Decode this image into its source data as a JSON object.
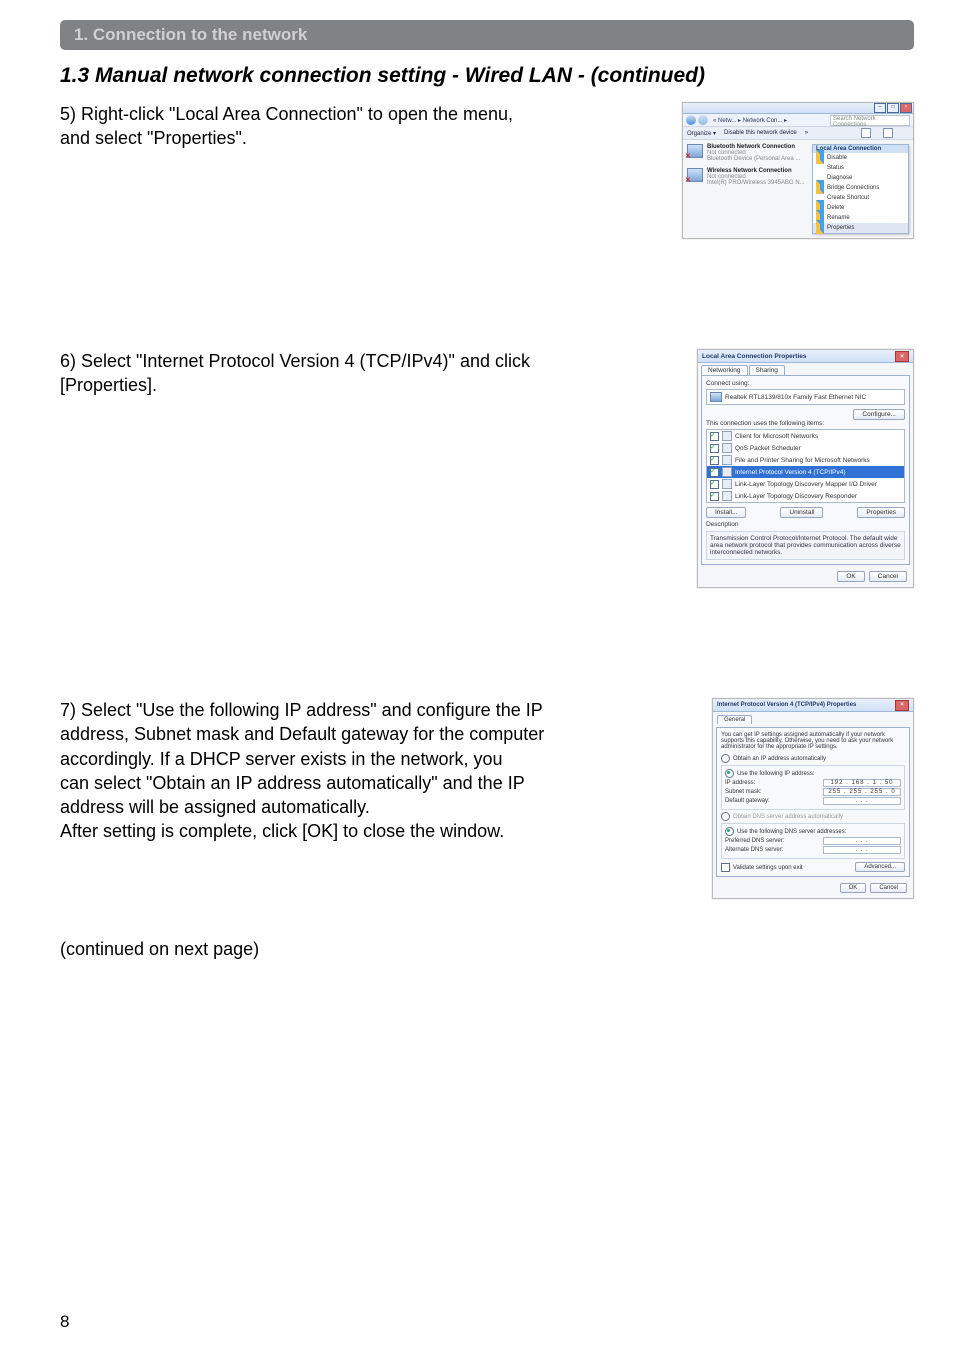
{
  "section_bar": "1. Connection to the network",
  "heading": "1.3 Manual network connection setting - Wired LAN - (continued)",
  "step5": "5) Right-click \"Local Area Connection\" to open the menu, \n     and select \"Properties\".",
  "step6": "6) Select \"Internet Protocol Version 4 (TCP/IPv4)\" and click \n     [Properties].",
  "step7": "7) Select \"Use the following IP address\" and configure the IP \n     address, Subnet mask and Default gateway for the computer \n     accordingly. If a DHCP server exists in the network, you \n     can select \"Obtain an IP address automatically\" and the IP \n     address will be assigned automatically.\n     After setting is complete, click [OK] to close the window.",
  "continued": "(continued on next page)",
  "page_num": "8",
  "ss1": {
    "crumb": "« Netw... ▸ Network Con...  ▸",
    "search_placeholder": "Search Network Connections",
    "organize": "Organize ▾",
    "disable": "Disable this network device",
    "items": [
      {
        "title": "Bluetooth Network Connection",
        "sub1": "Not connected",
        "sub2": "Bluetooth Device (Personal Area ..."
      },
      {
        "title": "Wireless Network Connection",
        "sub1": "Not connected",
        "sub2": "Intel(R) PRO/Wireless 3945ABG N..."
      }
    ],
    "menu_header": "Local Area Connection",
    "menu": [
      "Disable",
      "Status",
      "Diagnose",
      "Bridge Connections",
      "Create Shortcut",
      "Delete",
      "Rename",
      "Properties"
    ]
  },
  "ss2": {
    "title": "Local Area Connection Properties",
    "tabs": [
      "Networking",
      "Sharing"
    ],
    "connect_using_label": "Connect using:",
    "adapter": "Realtek RTL8139/810x Family Fast Ethernet NIC",
    "configure": "Configure...",
    "list_label": "This connection uses the following items:",
    "items": [
      "Client for Microsoft Networks",
      "QoS Packet Scheduler",
      "File and Printer Sharing for Microsoft Networks",
      "Internet Protocol Version 4 (TCP/IPv4)",
      "Link-Layer Topology Discovery Mapper I/O Driver",
      "Link-Layer Topology Discovery Responder"
    ],
    "install": "Install...",
    "uninstall": "Uninstall",
    "properties": "Properties",
    "desc_label": "Description",
    "desc": "Transmission Control Protocol/Internet Protocol. The default wide area network protocol that provides communication across diverse interconnected networks.",
    "ok": "OK",
    "cancel": "Cancel"
  },
  "ss3": {
    "title": "Internet Protocol Version 4 (TCP/IPv4) Properties",
    "tab": "General",
    "intro": "You can get IP settings assigned automatically if your network supports this capability. Otherwise, you need to ask your network administrator for the appropriate IP settings.",
    "obtain_ip": "Obtain an IP address automatically",
    "use_ip": "Use the following IP address:",
    "ip_label": "IP address:",
    "ip_val": "192 . 168 .  1  . 50",
    "mask_label": "Subnet mask:",
    "mask_val": "255 . 255 . 255 .  0",
    "gw_label": "Default gateway:",
    "gw_val": " .       .       . ",
    "obtain_dns": "Obtain DNS server address automatically",
    "use_dns": "Use the following DNS server addresses:",
    "pref_dns": "Preferred DNS server:",
    "alt_dns": "Alternate DNS server:",
    "dns_blank": " .       .       . ",
    "validate": "Validate settings upon exit",
    "advanced": "Advanced...",
    "ok": "OK",
    "cancel": "Cancel"
  }
}
